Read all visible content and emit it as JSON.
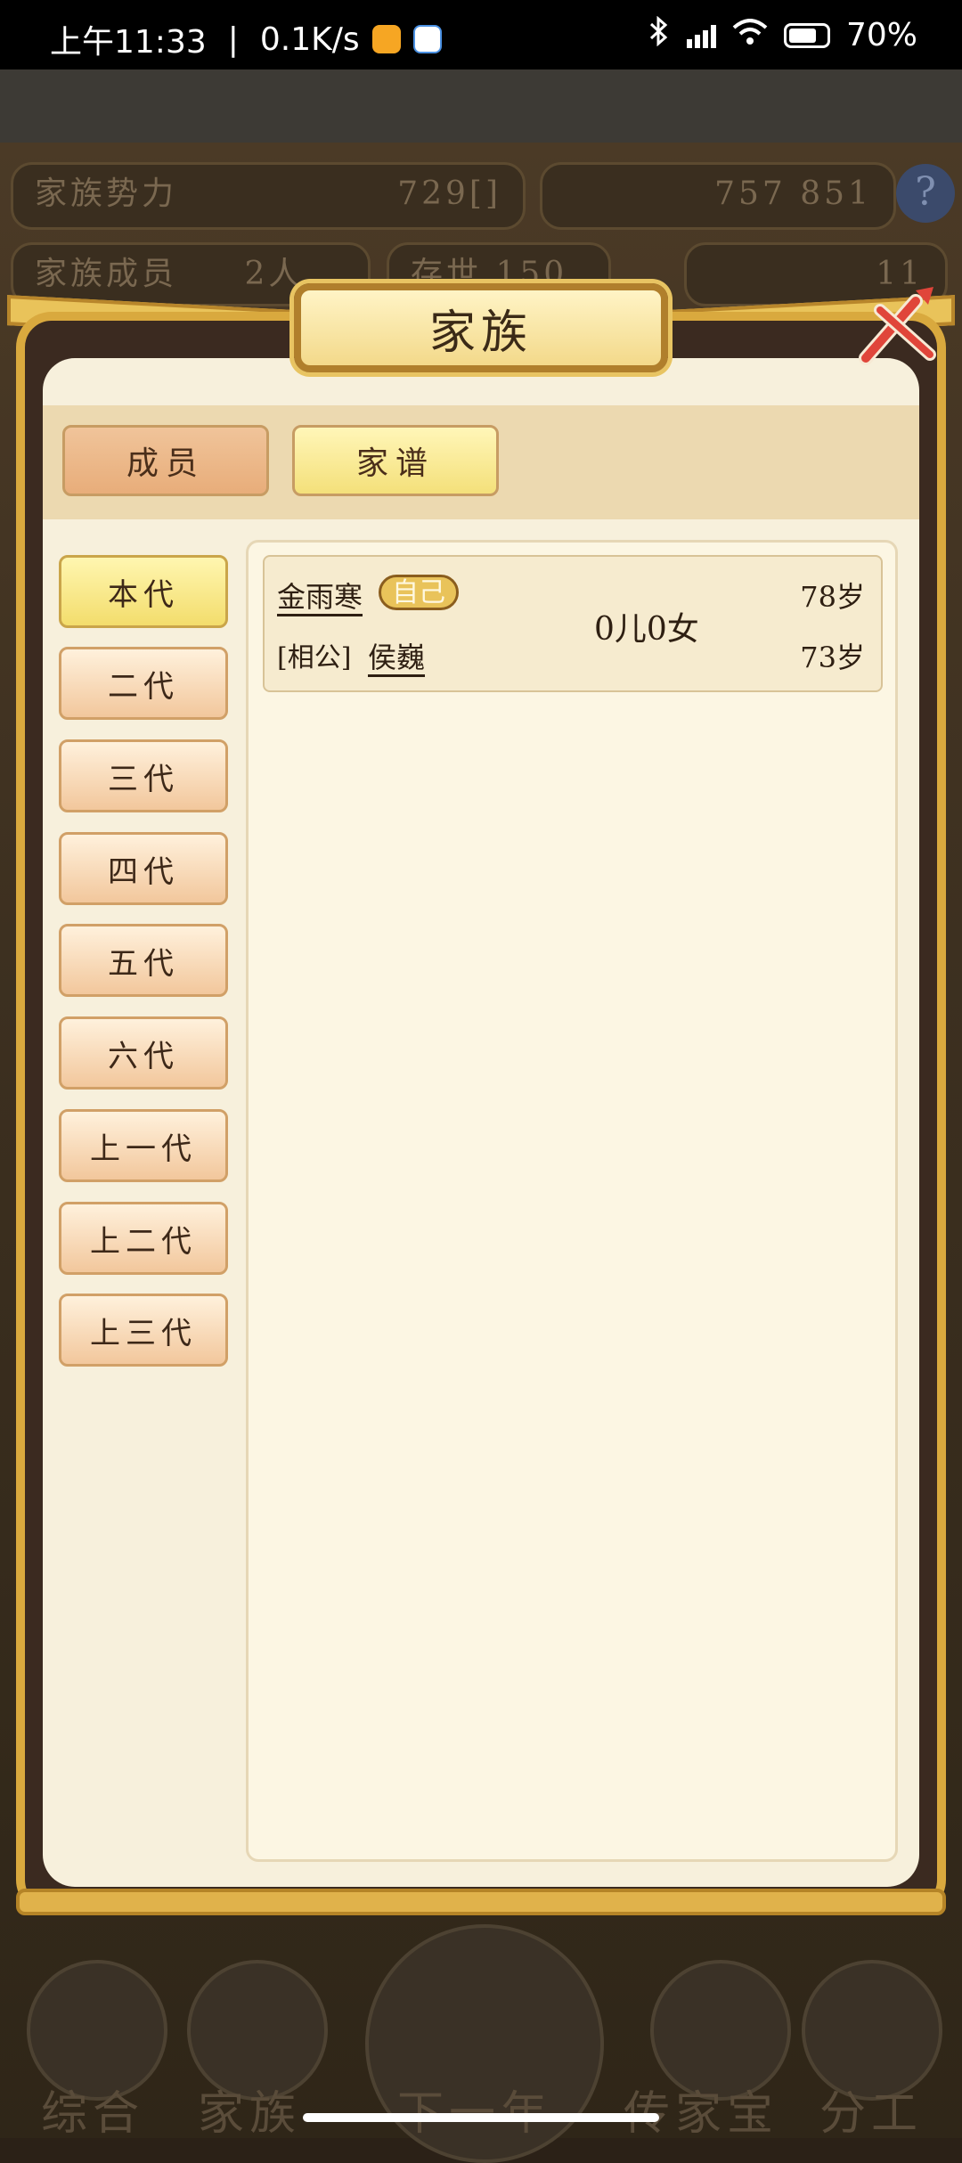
{
  "status_bar": {
    "time": "上午11:33",
    "separator": "|",
    "net_speed": "0.1K/s",
    "battery": "70%"
  },
  "background": {
    "family_power_label": "家族势力",
    "family_power_value": "729[",
    "family_power_tail": "]",
    "resource_a": "757",
    "resource_b": "851",
    "members_label": "家族成员",
    "members_value": "2人",
    "era_label": "存世",
    "era_value": "150年",
    "gold": "11",
    "nav": [
      "综合",
      "家族",
      "下一年",
      "传家宝",
      "分工"
    ]
  },
  "modal": {
    "title": "家族",
    "close_icon": "close-icon",
    "tabs": [
      {
        "label": "成员",
        "active": false
      },
      {
        "label": "家谱",
        "active": true
      }
    ],
    "generations": [
      {
        "label": "本代",
        "active": true
      },
      {
        "label": "二代",
        "active": false
      },
      {
        "label": "三代",
        "active": false
      },
      {
        "label": "四代",
        "active": false
      },
      {
        "label": "五代",
        "active": false
      },
      {
        "label": "六代",
        "active": false
      },
      {
        "label": "上一代",
        "active": false
      },
      {
        "label": "上二代",
        "active": false
      },
      {
        "label": "上三代",
        "active": false
      }
    ],
    "member": {
      "name": "金雨寒",
      "self_tag": "自己",
      "age": "78岁",
      "children": "0儿0女",
      "spouse_prefix": "[相公]",
      "spouse_name": "侯巍",
      "spouse_age": "73岁"
    }
  },
  "colors": {
    "frame_gold": "#d9a93e",
    "panel_bg": "#f7f0dc",
    "active_tab": "#f4e07a",
    "inactive_tab": "#e8ad7a",
    "close_accent": "#e0453a"
  }
}
